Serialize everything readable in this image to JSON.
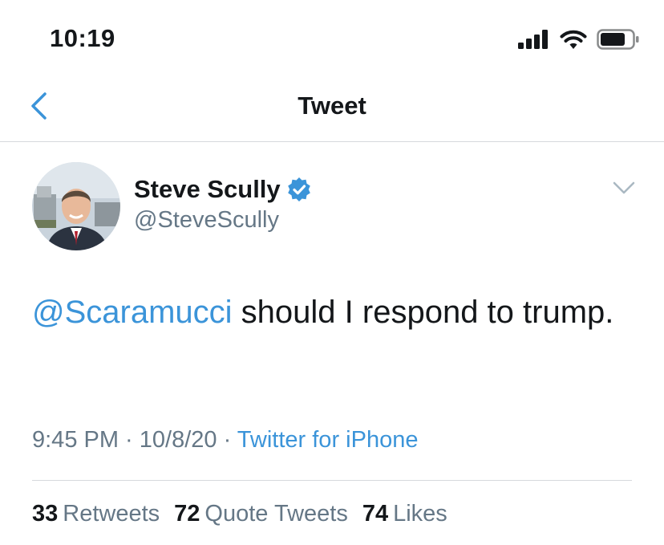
{
  "status_bar": {
    "time": "10:19",
    "icons": [
      "signal-icon",
      "wifi-icon",
      "battery-icon"
    ]
  },
  "nav": {
    "back_icon": "chevron-left-icon",
    "title": "Tweet"
  },
  "tweet": {
    "author": {
      "name": "Steve Scully",
      "handle": "@SteveScully",
      "verified": true
    },
    "text": {
      "mention": "@Scaramucci",
      "body": " should I respond to trump."
    },
    "meta": {
      "time": "9:45 PM",
      "separator1": " · ",
      "date": "10/8/20",
      "separator2": " · ",
      "source": "Twitter for iPhone"
    },
    "stats": {
      "retweets_count": "33",
      "retweets_label": "Retweets",
      "quote_count": "72",
      "quote_label": "Quote Tweets",
      "likes_count": "74",
      "likes_label": "Likes"
    }
  },
  "colors": {
    "accent": "#1da1f2",
    "link": "#3b94d9",
    "text": "#14171a",
    "secondary": "#657786",
    "divider": "#d6d9dc"
  }
}
